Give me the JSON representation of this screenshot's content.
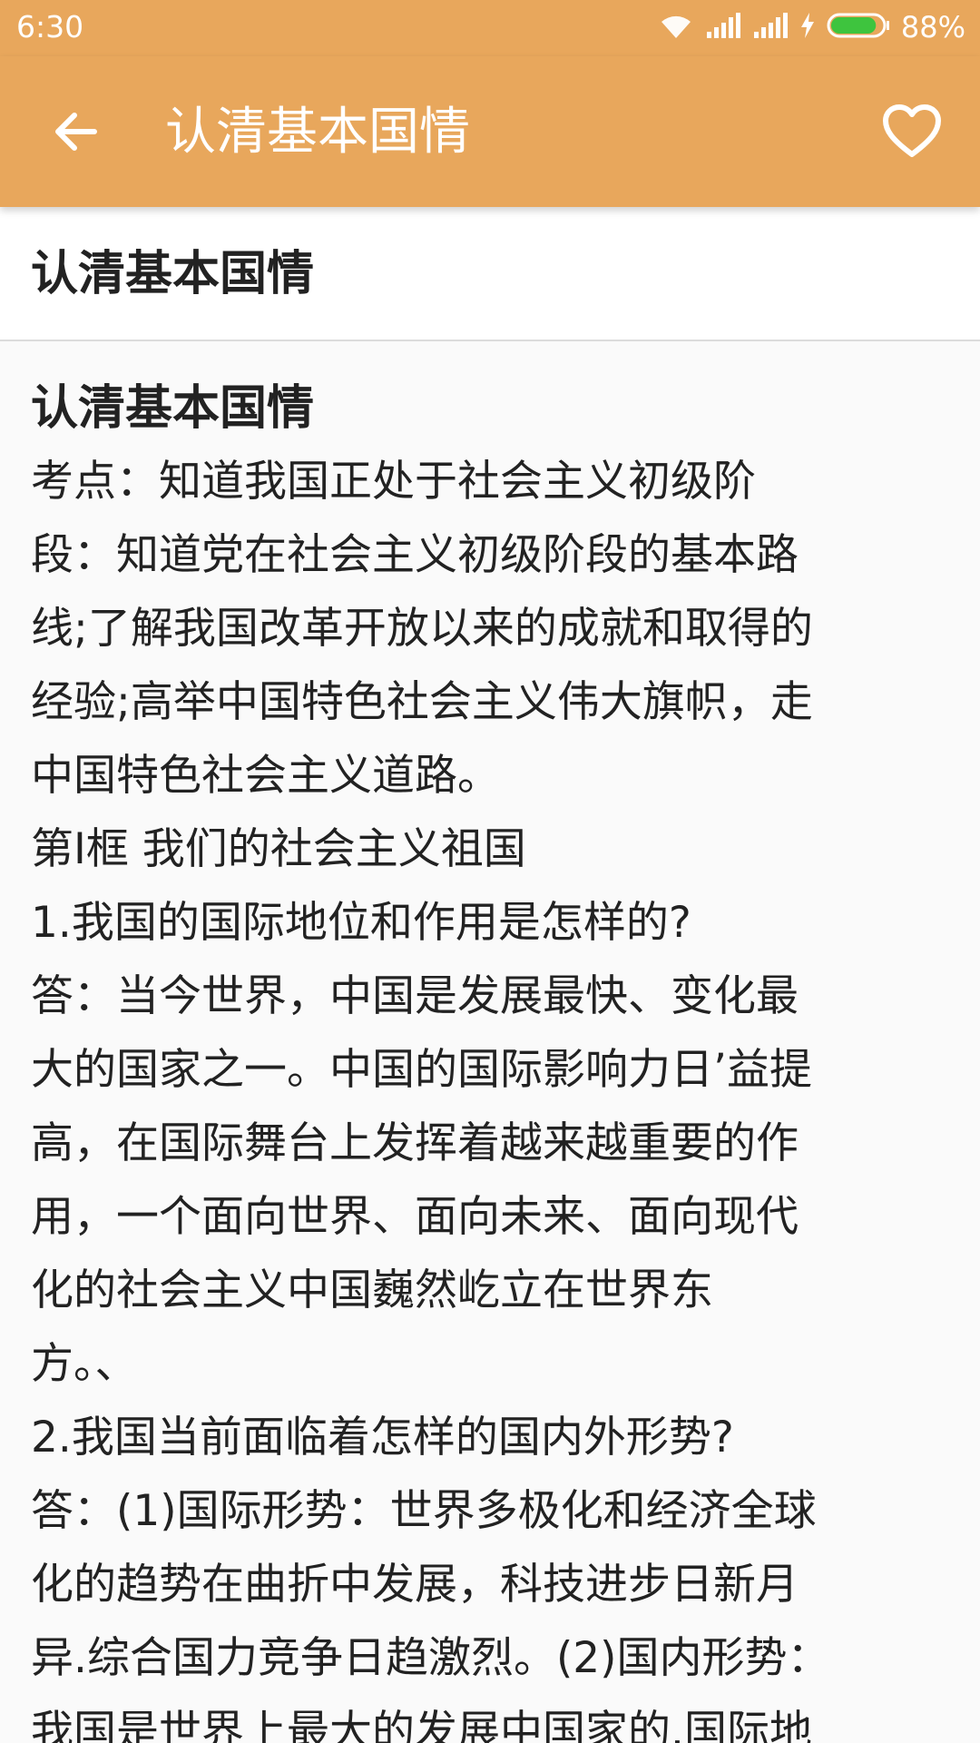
{
  "status_bar": {
    "time": "6:30",
    "battery_percent": "88%",
    "icons": [
      "wifi-icon",
      "signal-icon",
      "signal-icon",
      "charging-icon",
      "battery-icon"
    ],
    "battery_level": 0.88
  },
  "app_bar": {
    "title": "认清基本国情",
    "back_icon": "back-arrow-icon",
    "favorite_icon": "heart-outline-icon",
    "color": "#e8a75c"
  },
  "header": {
    "title": "认清基本国情"
  },
  "content": {
    "title": "认清基本国情",
    "lines": [
      "考点：知道我国正处于社会主义初级阶",
      "段：知道党在社会主义初级阶段的基本路",
      "线;了解我国改革开放以来的成就和取得的",
      "经验;高举中国特色社会主义伟大旗帜，走",
      "中国特色社会主义道路。",
      "第I框 我们的社会主义祖国",
      "1.我国的国际地位和作用是怎样的?",
      "答：当今世界，中国是发展最快、变化最",
      "大的国家之一。中国的国际影响力日’益提",
      "高，在国际舞台上发挥着越来越重要的作",
      "用，一个面向世界、面向未来、面向现代",
      "化的社会主义中国巍然屹立在世界东",
      "方。、",
      "2.我国当前面临着怎样的国内外形势?",
      "答：(1)国际形势：世界多极化和经济全球",
      "化的趋势在曲折中发展，科技进步日新月",
      "异.综合国力竞争日趋激烈。(2)国内形势：",
      "我国是世界上最大的发展中国家的.国际地"
    ]
  }
}
